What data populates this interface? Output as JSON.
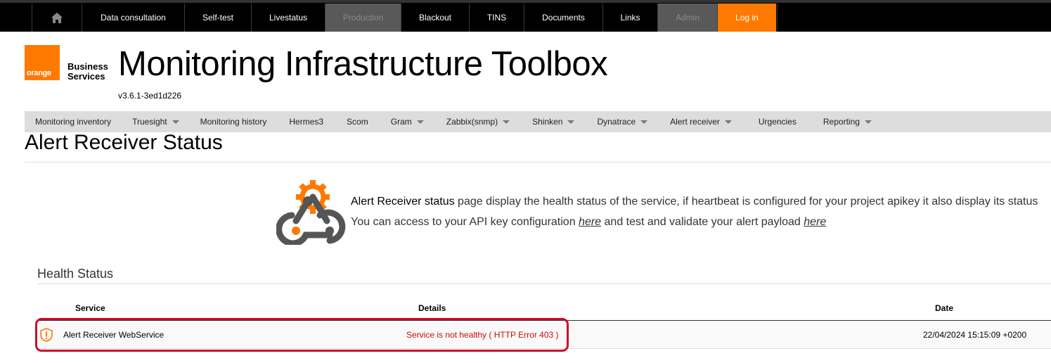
{
  "topnav": {
    "items": [
      {
        "label": "Data consultation"
      },
      {
        "label": "Self-test"
      },
      {
        "label": "Livestatus"
      },
      {
        "label": "Production"
      },
      {
        "label": "Blackout"
      },
      {
        "label": "TINS"
      },
      {
        "label": "Documents"
      },
      {
        "label": "Links"
      },
      {
        "label": "Admin"
      },
      {
        "label": "Log in"
      }
    ]
  },
  "header": {
    "logo_text": "orange",
    "business_line1": "Business",
    "business_line2": "Services",
    "title": "Monitoring Infrastructure Toolbox",
    "version": "v3.6.1-3ed1d226"
  },
  "subnav": {
    "items": [
      {
        "label": "Monitoring inventory"
      },
      {
        "label": "Truesight"
      },
      {
        "label": "Monitoring history"
      },
      {
        "label": "Hermes3"
      },
      {
        "label": "Scom"
      },
      {
        "label": "Gram"
      },
      {
        "label": "Zabbix(snmp)"
      },
      {
        "label": "Shinken"
      },
      {
        "label": "Dynatrace"
      },
      {
        "label": "Alert receiver"
      },
      {
        "label": "Urgencies"
      },
      {
        "label": "Reporting"
      }
    ]
  },
  "page": {
    "title": "Alert Receiver Status",
    "intro_strong": "Alert Receiver status",
    "intro_rest": " page display the health status of the service, if heartbeat is configured for your project apikey it also display its status",
    "intro2_a": "You can access to your API key configuration ",
    "intro2_link1": "here",
    "intro2_b": " and test and validate your alert payload ",
    "intro2_link2": "here"
  },
  "health": {
    "section_title": "Health Status",
    "columns": {
      "service": "Service",
      "details": "Details",
      "date": "Date"
    },
    "rows": [
      {
        "service": "Alert Receiver WebService",
        "details": "Service is not healthy ( HTTP Error 403 )",
        "date": "22/04/2024 15:15:09 +0200"
      }
    ]
  },
  "colors": {
    "brand": "#ff7900",
    "error": "#cd0a0a",
    "highlight": "#cf0a2c"
  }
}
